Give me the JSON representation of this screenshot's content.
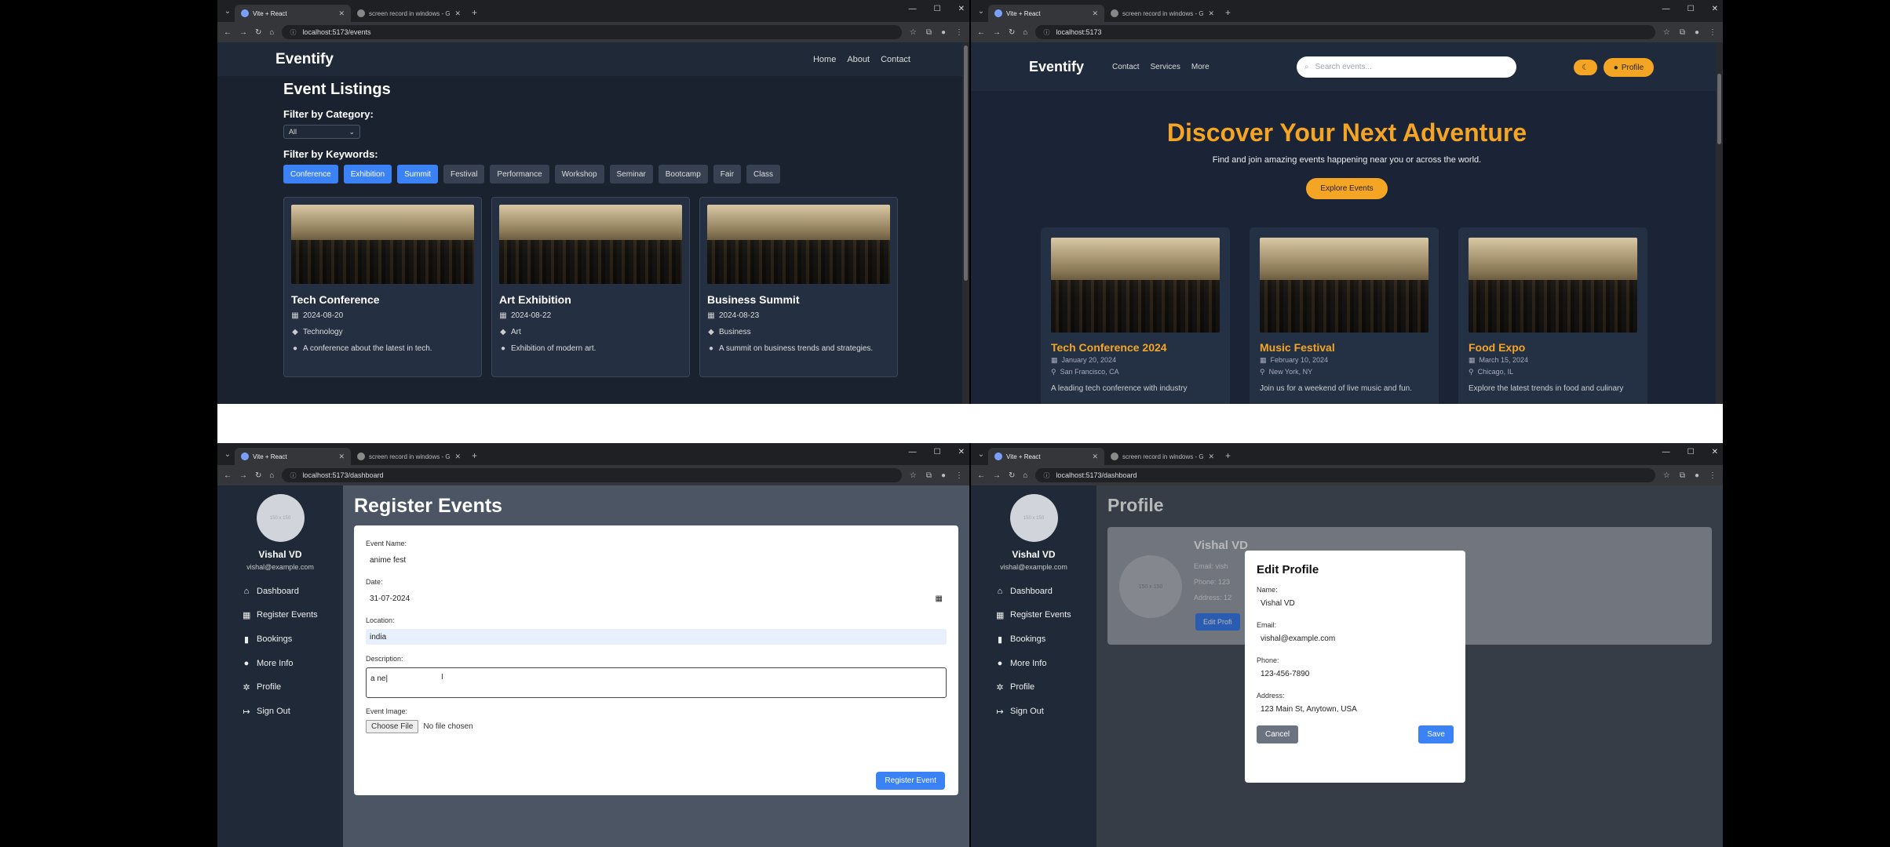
{
  "w1": {
    "tabs": [
      {
        "title": "Vite + React"
      },
      {
        "title": "screen record in windows - Goo"
      }
    ],
    "url": "localhost:5173/events",
    "brand": "Eventify",
    "nav": [
      "Home",
      "About",
      "Contact"
    ],
    "heading": "Event Listings",
    "filter_category_label": "Filter by Category:",
    "category_value": "All",
    "filter_keywords_label": "Filter by Keywords:",
    "chips": [
      {
        "label": "Conference",
        "active": true
      },
      {
        "label": "Exhibition",
        "active": true
      },
      {
        "label": "Summit",
        "active": true
      },
      {
        "label": "Festival",
        "active": false
      },
      {
        "label": "Performance",
        "active": false
      },
      {
        "label": "Workshop",
        "active": false
      },
      {
        "label": "Seminar",
        "active": false
      },
      {
        "label": "Bootcamp",
        "active": false
      },
      {
        "label": "Fair",
        "active": false
      },
      {
        "label": "Class",
        "active": false
      }
    ],
    "cards": [
      {
        "title": "Tech Conference",
        "date": "2024-08-20",
        "category": "Technology",
        "desc": "A conference about the latest in tech."
      },
      {
        "title": "Art Exhibition",
        "date": "2024-08-22",
        "category": "Art",
        "desc": "Exhibition of modern art."
      },
      {
        "title": "Business Summit",
        "date": "2024-08-23",
        "category": "Business",
        "desc": "A summit on business trends and strategies."
      }
    ]
  },
  "w2": {
    "tabs": [
      {
        "title": "Vite + React"
      },
      {
        "title": "screen record in windows - Goo"
      }
    ],
    "url": "localhost:5173",
    "brand": "Eventify",
    "nav": [
      "Contact",
      "Services",
      "More"
    ],
    "search_placeholder": "Search events...",
    "profile_label": "Profile",
    "hero_title": "Discover Your Next Adventure",
    "hero_sub": "Find and join amazing events happening near you or across the world.",
    "hero_button": "Explore Events",
    "cards": [
      {
        "title": "Tech Conference 2024",
        "date": "January 20, 2024",
        "location": "San Francisco, CA",
        "desc": "A leading tech conference with industry"
      },
      {
        "title": "Music Festival",
        "date": "February 10, 2024",
        "location": "New York, NY",
        "desc": "Join us for a weekend of live music and fun."
      },
      {
        "title": "Food Expo",
        "date": "March 15, 2024",
        "location": "Chicago, IL",
        "desc": "Explore the latest trends in food and culinary"
      }
    ]
  },
  "w3": {
    "tabs": [
      {
        "title": "Vite + React"
      },
      {
        "title": "screen record in windows - Goo"
      }
    ],
    "url": "localhost:5173/dashboard",
    "avatar_text": "150 x 150",
    "user_name": "Vishal VD",
    "user_email": "vishal@example.com",
    "menu": [
      "Dashboard",
      "Register Events",
      "Bookings",
      "More Info",
      "Profile",
      "Sign Out"
    ],
    "heading": "Register Events",
    "event_name_label": "Event Name:",
    "event_name_value": "anime fest",
    "date_label": "Date:",
    "date_value": "31-07-2024",
    "location_label": "Location:",
    "location_value": "india",
    "description_label": "Description:",
    "description_value": "a ne|",
    "image_label": "Event Image:",
    "choose_file": "Choose File",
    "no_file": "No file chosen",
    "submit": "Register Event"
  },
  "w4": {
    "tabs": [
      {
        "title": "Vite + React"
      },
      {
        "title": "screen record in windows - Goo"
      }
    ],
    "url": "localhost:5173/dashboard",
    "avatar_text": "150 x 150",
    "user_name": "Vishal VD",
    "user_email": "vishal@example.com",
    "menu": [
      "Dashboard",
      "Register Events",
      "Bookings",
      "More Info",
      "Profile",
      "Sign Out"
    ],
    "heading": "Profile",
    "card_name": "Vishal VD",
    "card_email": "Email: vish",
    "card_phone": "Phone: 123",
    "card_address": "Address: 12",
    "card_edit": "Edit Profi",
    "modal_title": "Edit Profile",
    "name_label": "Name:",
    "name_value": "Vishal VD",
    "email_label": "Email:",
    "email_value": "vishal@example.com",
    "phone_label": "Phone:",
    "phone_value": "123-456-7890",
    "address_label": "Address:",
    "address_value": "123 Main St, Anytown, USA",
    "cancel": "Cancel",
    "save": "Save"
  }
}
